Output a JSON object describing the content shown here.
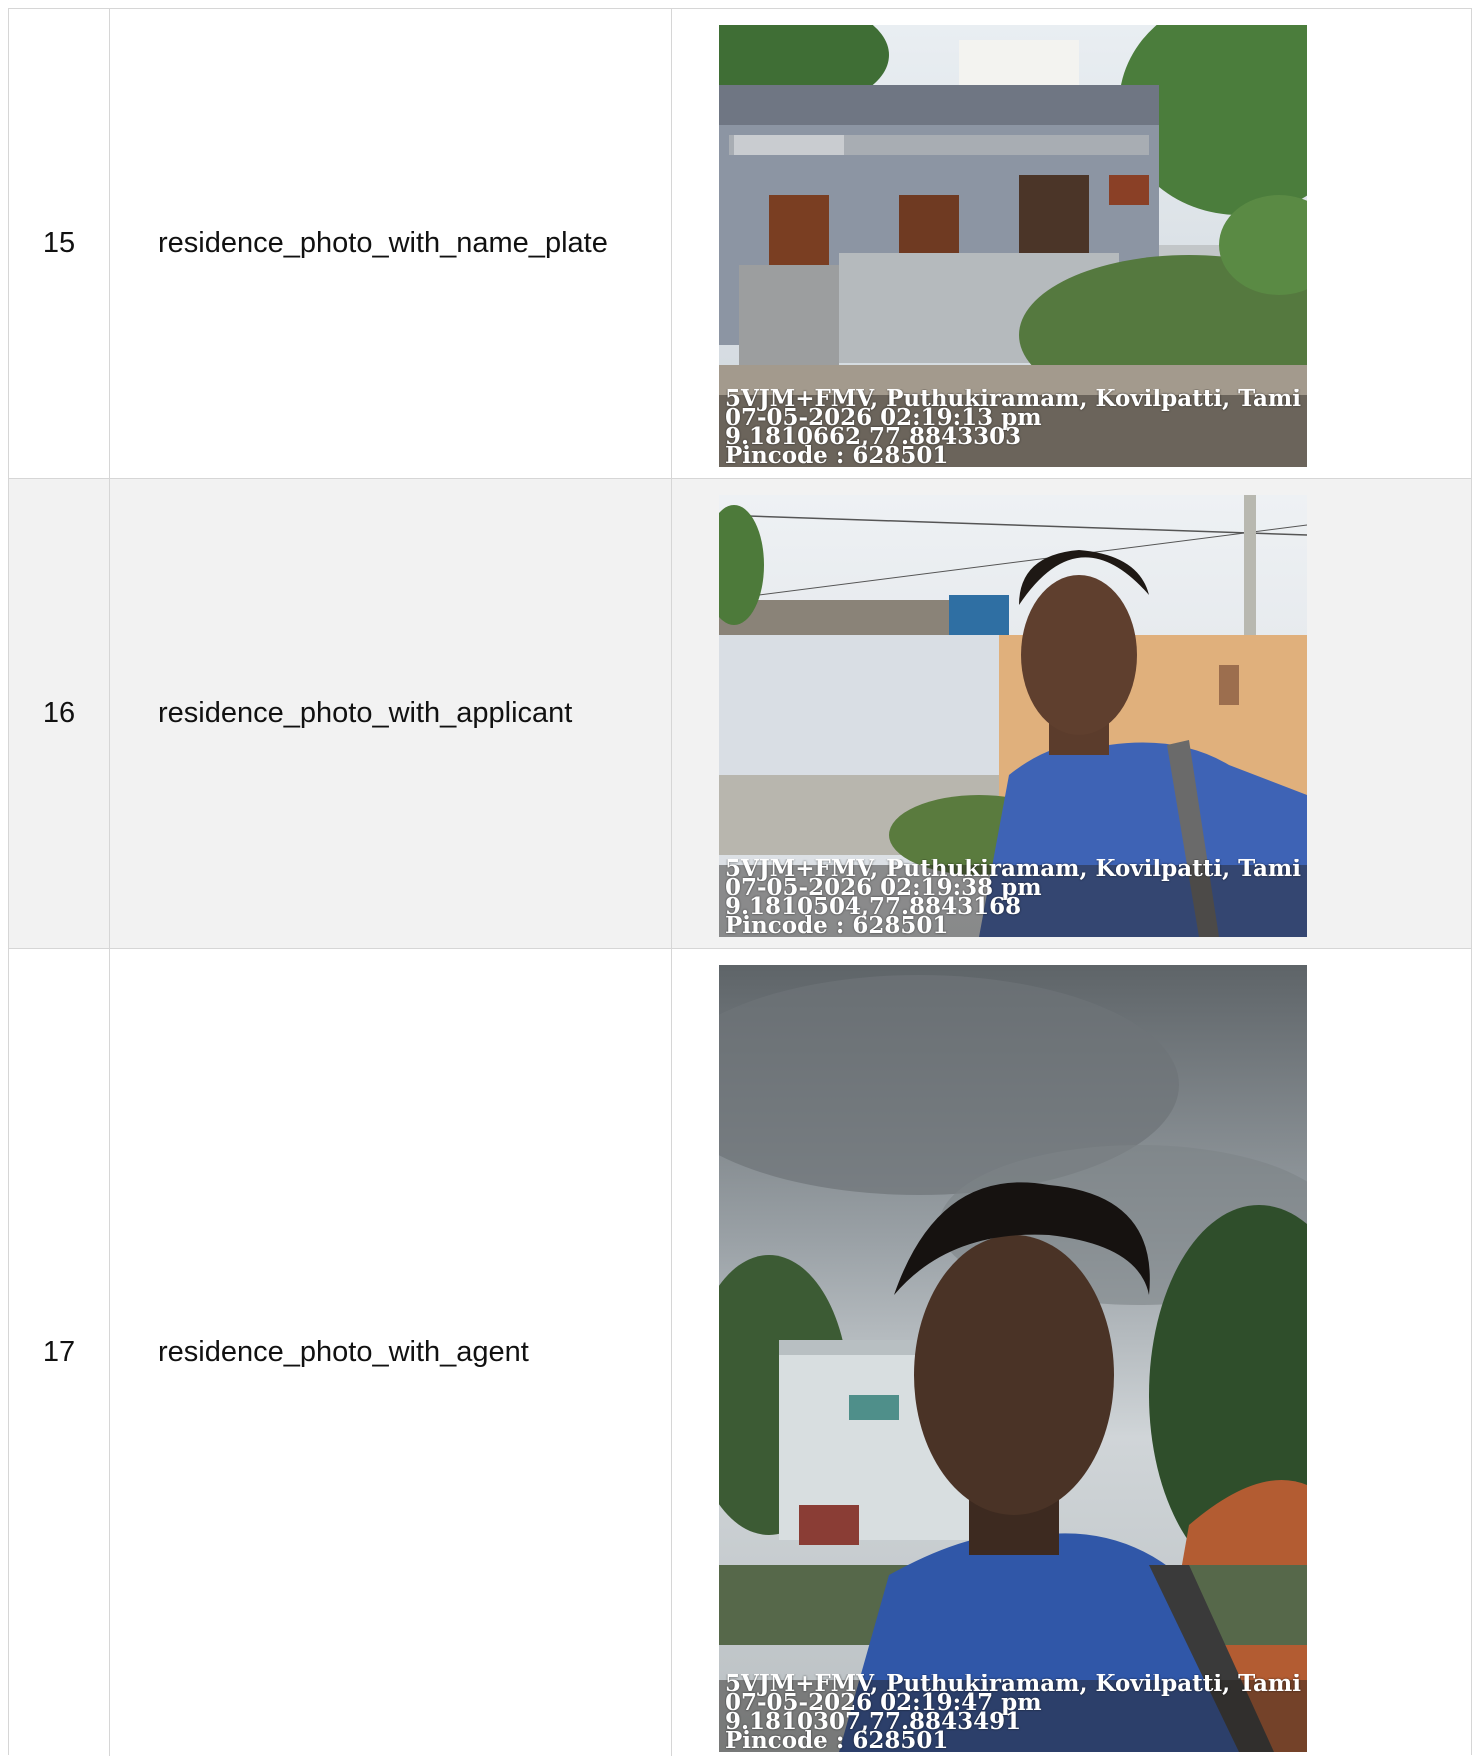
{
  "rows": [
    {
      "index": "15",
      "field": "residence_photo_with_name_plate",
      "stamp": {
        "address": "5VJM+FMV, Puthukiramam, Kovilpatti, Tami",
        "datetime": "07-05-2026 02:19:13 pm",
        "coords": "9.1810662,77.8843303",
        "pincode": "Pincode : 628501"
      }
    },
    {
      "index": "16",
      "field": "residence_photo_with_applicant",
      "stamp": {
        "address": "5VJM+FMV, Puthukiramam, Kovilpatti, Tami",
        "datetime": "07-05-2026 02:19:38 pm",
        "coords": "9.1810504,77.8843168",
        "pincode": "Pincode : 628501"
      }
    },
    {
      "index": "17",
      "field": "residence_photo_with_agent",
      "stamp": {
        "address": "5VJM+FMV, Puthukiramam, Kovilpatti, Tami",
        "datetime": "07-05-2026 02:19:47 pm",
        "coords": "9.1810307,77.8843491",
        "pincode": "Pincode : 628501"
      }
    }
  ],
  "colors": {
    "border": "#d6d6d6",
    "alt_row": "#f2f2f2",
    "text": "#111111",
    "stamp_text": "#ffffff"
  }
}
